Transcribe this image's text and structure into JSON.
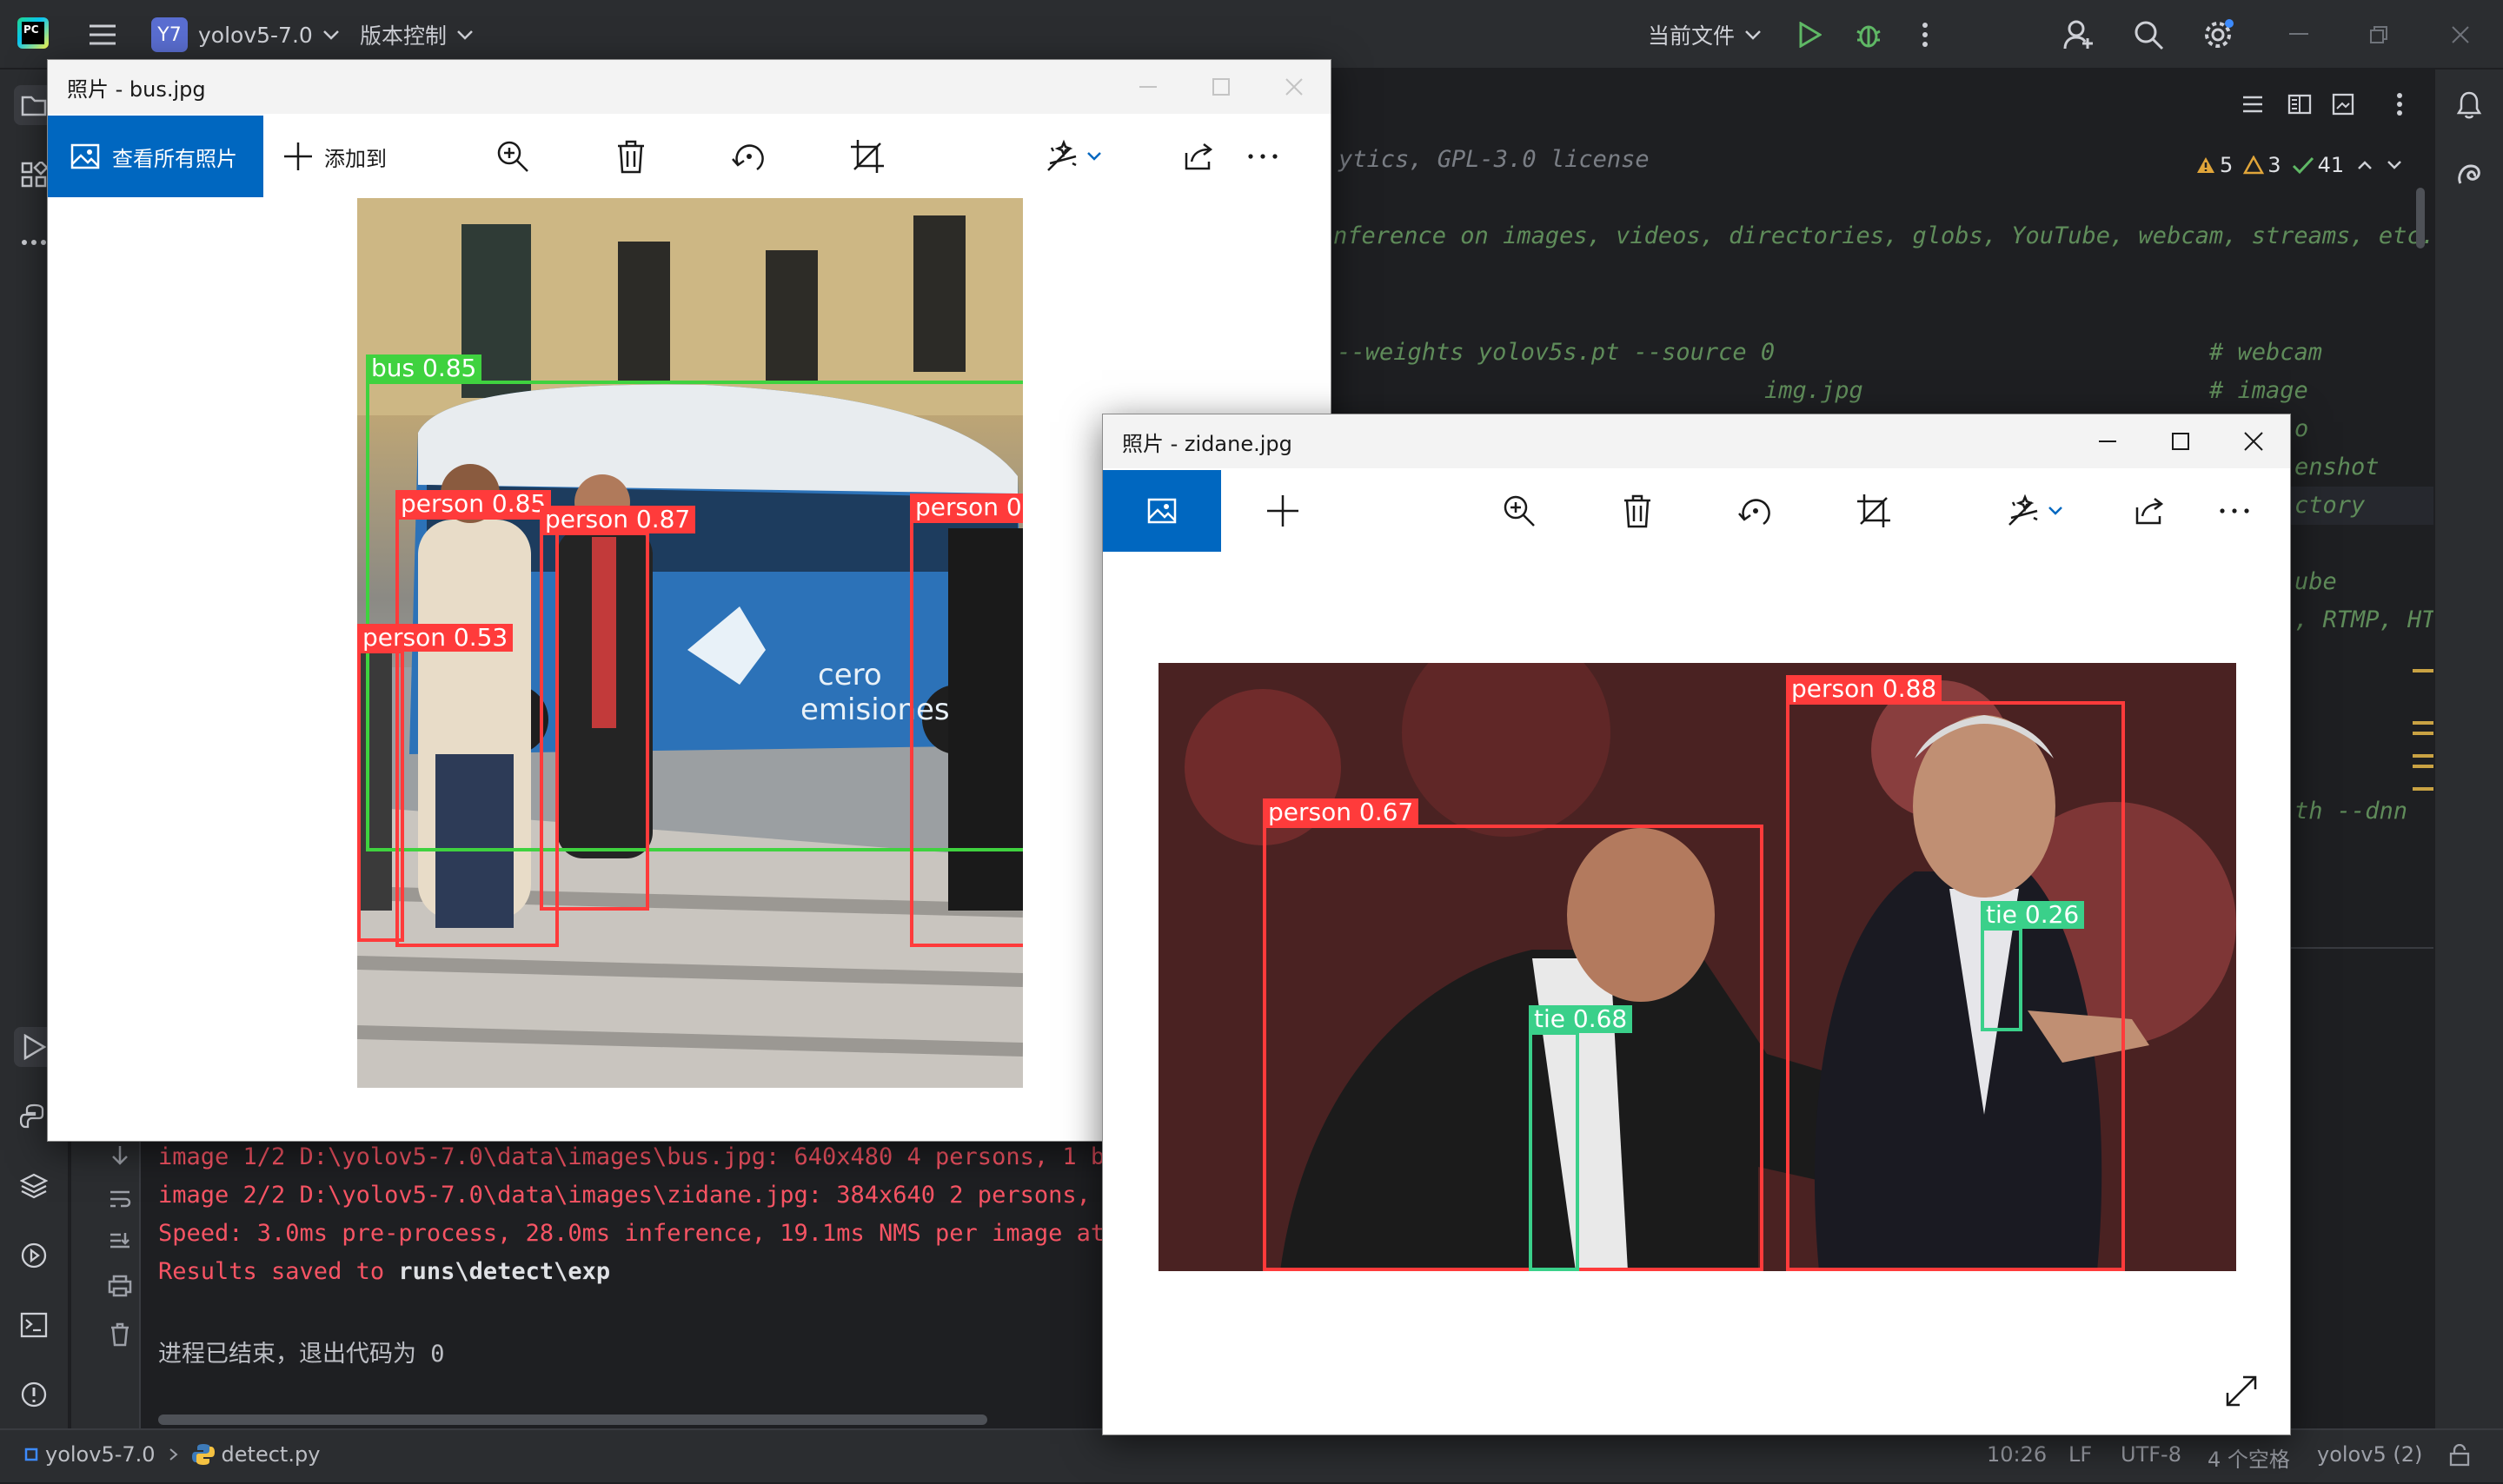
{
  "ide": {
    "project_badge": "Y7",
    "project_name": "yolov5-7.0",
    "vcs_label": "版本控制",
    "run_config": "当前文件",
    "inspections": {
      "warnings": "5",
      "weak_warnings": "3",
      "ok": "41"
    }
  },
  "editor": {
    "lines": [
      {
        "text": "ytics, GPL-3.0 license",
        "style": "cmt"
      },
      {
        "text": "nference on images, videos, directories, globs, YouTube, webcam, streams, etc.",
        "style": "grn"
      },
      {
        "text": " --weights yolov5s.pt --source 0",
        "style": "grn"
      },
      {
        "text": "# webcam",
        "style": "grn"
      },
      {
        "text": "img.jpg",
        "style": "grn"
      },
      {
        "text": "# image",
        "style": "grn"
      },
      {
        "text": "o",
        "style": "grn"
      },
      {
        "text": "enshot",
        "style": "grn"
      },
      {
        "text": "ctory",
        "style": "grn"
      },
      {
        "text": "ube",
        "style": "grn"
      },
      {
        "text": ", RTMP, HT",
        "style": "grn"
      },
      {
        "text": "th --dnn",
        "style": "grn"
      }
    ]
  },
  "console": {
    "lines": [
      "image 1/2 D:\\yolov5-7.0\\data\\images\\bus.jpg: 640x480 4 persons, 1 bu",
      "image 2/2 D:\\yolov5-7.0\\data\\images\\zidane.jpg: 384x640 2 persons, 2",
      "Speed: 3.0ms pre-process, 28.0ms inference, 19.1ms NMS per image at",
      "Results saved to runs\\detect\\exp"
    ],
    "exit_message": "进程已结束，退出代码为 0"
  },
  "status_bar": {
    "project": "yolov5-7.0",
    "file": "detect.py",
    "position": "10:26",
    "line_ending": "LF",
    "encoding": "UTF-8",
    "indent": "4 个空格",
    "interpreter": "yolov5 (2)"
  },
  "photo_window_1": {
    "title": "照片 - bus.jpg",
    "view_all": "查看所有照片",
    "add_to": "添加到",
    "detections": [
      {
        "label": "bus 0.85",
        "color": "#3fd23f"
      },
      {
        "label": "person 0.85",
        "color": "#ff3b3b"
      },
      {
        "label": "person 0.87",
        "color": "#ff3b3b"
      },
      {
        "label": "person 0",
        "color": "#ff3b3b"
      },
      {
        "label": "person 0.53",
        "color": "#ff3b3b"
      }
    ]
  },
  "photo_window_2": {
    "title": "照片 - zidane.jpg",
    "detections": [
      {
        "label": "person 0.88",
        "color": "#ff3b3b"
      },
      {
        "label": "person 0.67",
        "color": "#ff3b3b"
      },
      {
        "label": "tie 0.26",
        "color": "#3ad08a"
      },
      {
        "label": "tie 0.68",
        "color": "#3ad08a"
      }
    ]
  }
}
